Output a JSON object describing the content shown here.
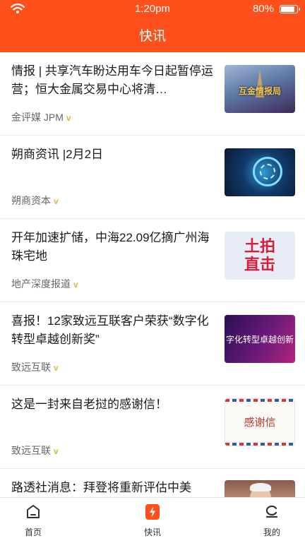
{
  "status_bar": {
    "time": "1:20pm",
    "battery": "80%",
    "battery_level": 0.8
  },
  "page_title": "快讯",
  "colors": {
    "accent": "#ff4f1a",
    "verified_badge": "#e0b33a"
  },
  "news": [
    {
      "title": "情报 | 共享汽车盼达用车今日起暂停运营；恒大金属交易中心将清…",
      "source": "金评媒 JPM",
      "verified": "v",
      "thumb_text": "互金情报局"
    },
    {
      "title": "朔商资讯 |2月2日",
      "source": "朔商资本",
      "verified": "v",
      "thumb_text": ""
    },
    {
      "title": "开年加速扩储，中海22.09亿摘广州海珠宅地",
      "source": "地产深度报道",
      "verified": "v",
      "thumb_text_top": "土拍",
      "thumb_text_bottom": "直击"
    },
    {
      "title": "喜报！12家致远互联客户荣获“数字化转型卓越创新奖”",
      "source": "致远互联",
      "verified": "v",
      "thumb_text": "字化转型卓越创新"
    },
    {
      "title": "这是一封来自老挝的感谢信！",
      "source": "致远互联",
      "verified": "v",
      "thumb_text": "感谢信"
    },
    {
      "title": "路透社消息：拜登将重新评估中美"
    }
  ],
  "tabs": [
    {
      "label": "首页",
      "icon": "home-icon"
    },
    {
      "label": "快讯",
      "icon": "flash-news-icon",
      "active": true
    },
    {
      "label": "我的",
      "icon": "profile-icon"
    }
  ]
}
